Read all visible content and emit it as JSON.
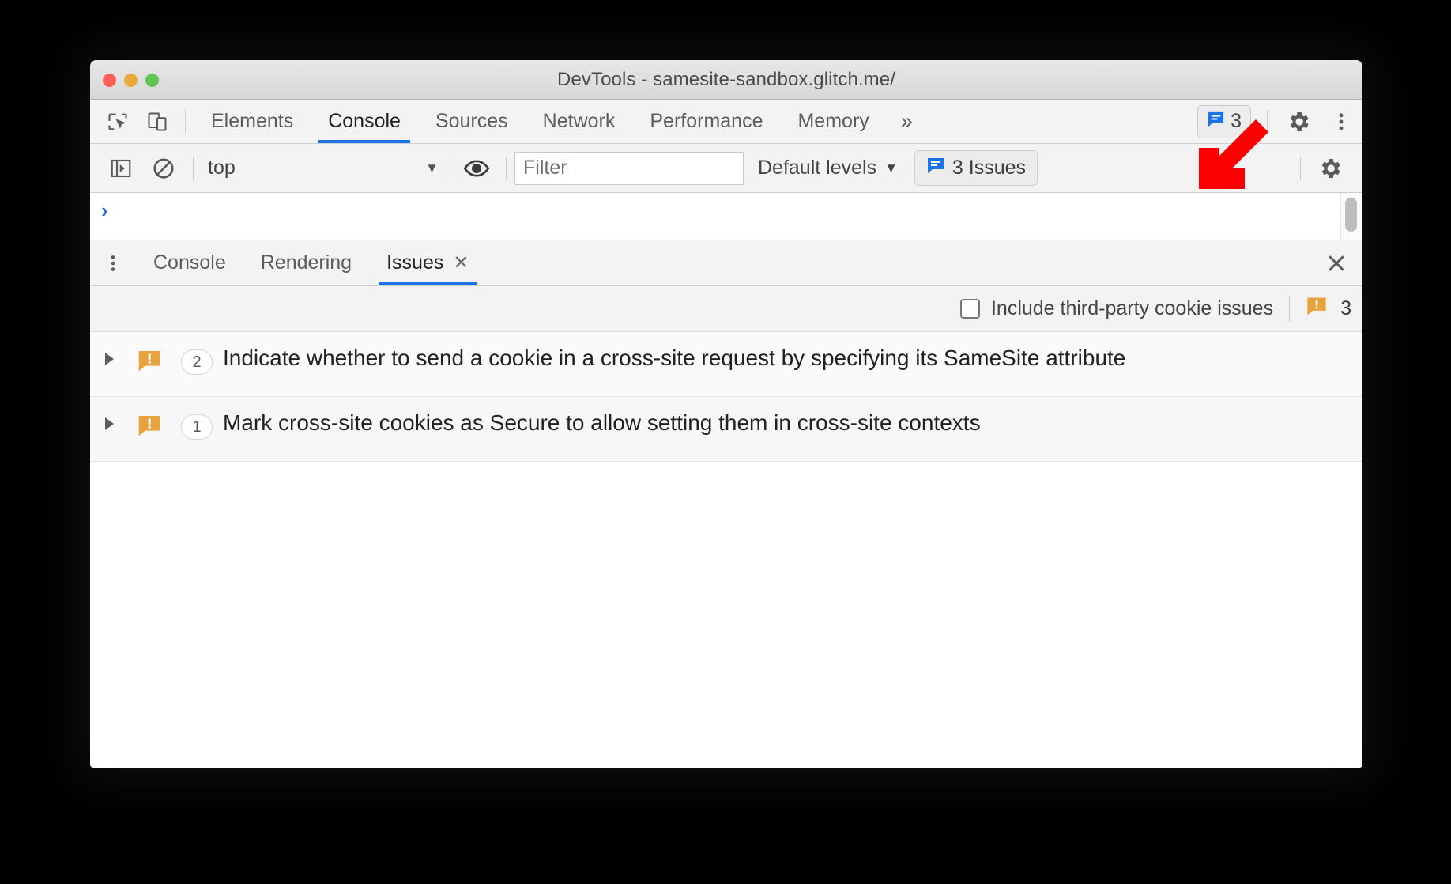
{
  "window": {
    "title": "DevTools - samesite-sandbox.glitch.me/",
    "traffic_lights": [
      "close",
      "minimize",
      "zoom"
    ]
  },
  "main_tabbar": {
    "left_icons": [
      {
        "name": "inspect-element-icon",
        "label": "Inspect element"
      },
      {
        "name": "device-toolbar-icon",
        "label": "Toggle device toolbar"
      }
    ],
    "tabs": [
      {
        "label": "Elements",
        "active": false
      },
      {
        "label": "Console",
        "active": true
      },
      {
        "label": "Sources",
        "active": false
      },
      {
        "label": "Network",
        "active": false
      },
      {
        "label": "Performance",
        "active": false
      },
      {
        "label": "Memory",
        "active": false
      }
    ],
    "more_tabs": "»",
    "issues_badge": {
      "count": "3",
      "icon": "issue-bubble-icon"
    },
    "settings_label": "Settings",
    "more_options_label": "Customize and control DevTools"
  },
  "console_toolbar": {
    "sidebar_toggle": "console-sidebar-icon",
    "clear_label": "Clear console",
    "context": "top",
    "context_caret": "▼",
    "eye_label": "Create live expression",
    "filter": {
      "value": "",
      "placeholder": "Filter"
    },
    "levels": {
      "label": "Default levels",
      "caret": "▼"
    },
    "issues_button": {
      "label": "3 Issues",
      "icon": "issue-bubble-icon"
    },
    "settings_label": "Console settings"
  },
  "console": {
    "prompt": "›"
  },
  "drawer": {
    "more_tools_label": "More tools",
    "tabs": [
      {
        "label": "Console",
        "active": false,
        "closable": false
      },
      {
        "label": "Rendering",
        "active": false,
        "closable": false
      },
      {
        "label": "Issues",
        "active": true,
        "closable": true,
        "close_glyph": "✕"
      }
    ],
    "close_glyph": "✕"
  },
  "issues_panel": {
    "third_party_checkbox": {
      "label": "Include third-party cookie issues",
      "checked": false
    },
    "count": "3",
    "count_icon": "issue-warning-bubble-icon",
    "rows": [
      {
        "expander": "▶",
        "icon": "issue-warning-bubble-icon",
        "count": "2",
        "title": "Indicate whether to send a cookie in a cross-site request by specifying its SameSite attribute"
      },
      {
        "expander": "▶",
        "icon": "issue-warning-bubble-icon",
        "count": "1",
        "title": "Mark cross-site cookies as Secure to allow setting them in cross-site contexts"
      }
    ]
  },
  "annotation": {
    "arrow": {
      "name": "red-pointer-arrow",
      "direction": "down-left",
      "color": "#fa0000"
    }
  },
  "colors": {
    "accent_blue": "#1a73e8",
    "warning_orange": "#e8a33d",
    "annotation_red": "#fa0000",
    "titlebar": "#dedede",
    "toolbar_bg": "#f3f3f3"
  }
}
